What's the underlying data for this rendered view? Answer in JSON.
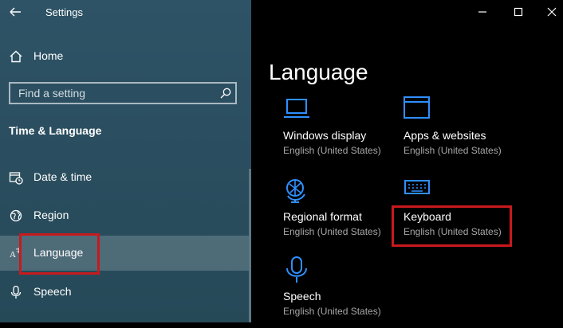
{
  "app": {
    "title": "Settings"
  },
  "sidebar": {
    "home_label": "Home",
    "search": {
      "placeholder": "Find a setting",
      "value": ""
    },
    "section_heading": "Time & Language",
    "items": [
      {
        "label": "Date & time",
        "icon": "date-time-icon"
      },
      {
        "label": "Region",
        "icon": "globe-icon"
      },
      {
        "label": "Language",
        "icon": "language-icon",
        "selected": true
      },
      {
        "label": "Speech",
        "icon": "microphone-icon"
      }
    ]
  },
  "main": {
    "page_title": "Language",
    "tiles": [
      {
        "title": "Windows display",
        "subtitle": "English (United States)",
        "icon": "laptop-icon"
      },
      {
        "title": "Apps & websites",
        "subtitle": "English (United States)",
        "icon": "window-icon"
      },
      {
        "title": "Regional format",
        "subtitle": "English (United States)",
        "icon": "regional-format-icon"
      },
      {
        "title": "Keyboard",
        "subtitle": "English (United States)",
        "icon": "keyboard-icon"
      },
      {
        "title": "Speech",
        "subtitle": "English (United States)",
        "icon": "microphone-icon"
      }
    ]
  },
  "colors": {
    "sidebar_bg": "#2e5366",
    "accent": "#2f8fff",
    "highlight_box": "#c8191e",
    "main_bg": "#000000"
  }
}
